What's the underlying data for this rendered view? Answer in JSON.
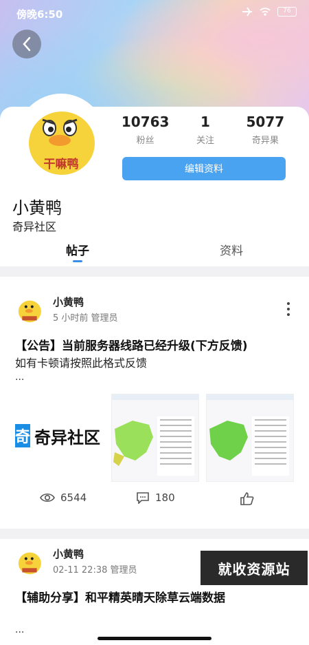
{
  "status_bar": {
    "time": "傍晚6:50",
    "battery": "76"
  },
  "profile": {
    "nickname": "小黄鸭",
    "community": "奇异社区",
    "avatar_text": "干嘛鸭",
    "stats": [
      {
        "value": "10763",
        "label": "粉丝"
      },
      {
        "value": "1",
        "label": "关注"
      },
      {
        "value": "5077",
        "label": "奇异果"
      }
    ],
    "edit_label": "编辑资料"
  },
  "tabs": [
    {
      "label": "帖子",
      "active": true
    },
    {
      "label": "资料",
      "active": false
    }
  ],
  "posts": [
    {
      "author": "小黄鸭",
      "meta": "5 小时前  管理员",
      "title": "【公告】当前服务器线路已经升级(下方反馈)",
      "body": "如有卡顿请按照此格式反馈",
      "ellipsis": "...",
      "image_logo_glyph": "奇",
      "image_logo_text": "奇异社区",
      "views": "6544",
      "comments": "180"
    },
    {
      "author": "小黄鸭",
      "meta": "02-11 22:38  管理员",
      "title": "【辅助分享】和平精英晴天除草云端数据",
      "ellipsis": "..."
    }
  ],
  "watermark": "就收资源站",
  "colors": {
    "accent": "#4aa3f0",
    "tab_indicator": "#3a8ee6"
  }
}
